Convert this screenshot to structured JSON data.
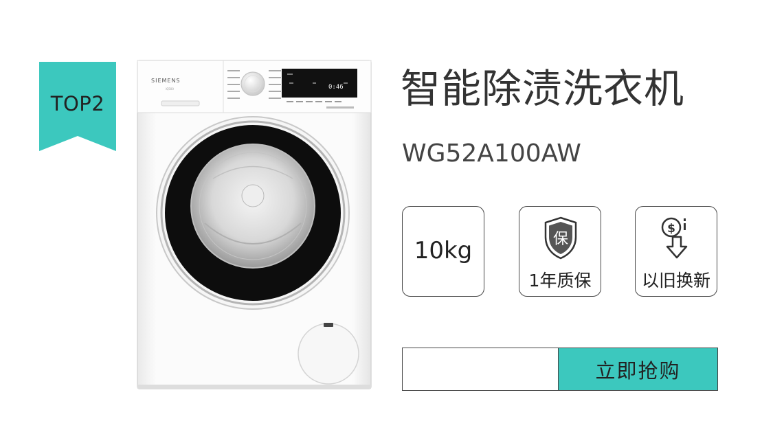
{
  "badge": {
    "label": "TOP2",
    "color": "#3cc8be"
  },
  "product": {
    "title": "智能除渍洗衣机",
    "model": "WG52A100AW",
    "brand_mark": "SIEMENS",
    "display_time": "0:46",
    "image_icon": "washing-machine-icon"
  },
  "features": [
    {
      "value": "10kg",
      "icon": null
    },
    {
      "caption": "1年质保",
      "icon": "shield-guarantee-icon",
      "icon_glyph": "保"
    },
    {
      "caption": "以旧换新",
      "icon": "coin-exchange-icon",
      "icon_glyph": "$"
    }
  ],
  "cta": {
    "label": "立即抢购",
    "color": "#3cc8be"
  }
}
